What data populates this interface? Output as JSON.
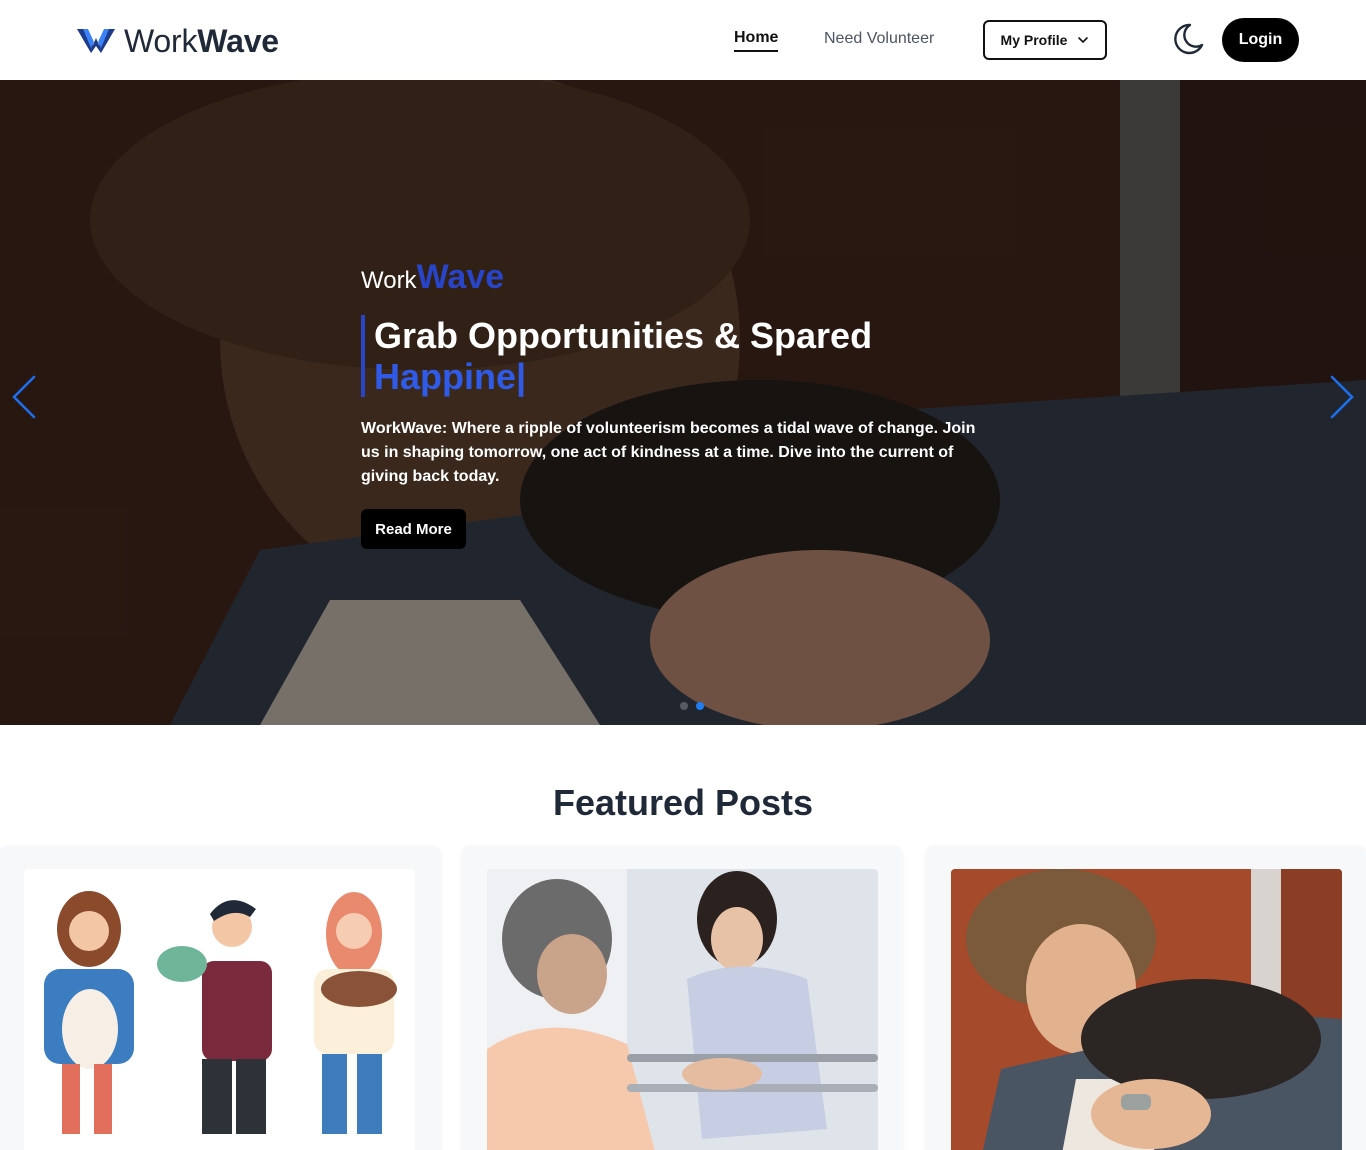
{
  "brand": {
    "part1": "Work",
    "part2": "Wave"
  },
  "nav": {
    "home": "Home",
    "need_volunteer": "Need Volunteer",
    "my_profile": "My Profile",
    "login": "Login"
  },
  "hero": {
    "brand_part1": "Work",
    "brand_part2": "Wave",
    "title_line1": "Grab Opportunities & Spared",
    "title_typed": "Happine",
    "caret": "|",
    "description": "WorkWave: Where a ripple of volunteerism becomes a tidal wave of change. Join us in shaping tomorrow, one act of kindness at a time. Dive into the current of giving back today.",
    "read_more": "Read More",
    "slide_count": 2,
    "active_slide": 2
  },
  "featured": {
    "title": "Featured Posts",
    "cards": [
      {
        "image": "kids-with-pets-illustration"
      },
      {
        "image": "nurse-helping-elderly-woman"
      },
      {
        "image": "man-hugging-dog"
      }
    ]
  },
  "colors": {
    "accent": "#2845c9",
    "caret_blue": "#2f5be8",
    "active_dot": "#1e7ef0",
    "button_black": "#000000"
  },
  "icons": {
    "logo": "workwave-logo-icon",
    "theme_toggle": "moon-icon",
    "dropdown": "chevron-down-icon",
    "prev": "chevron-left-icon",
    "next": "chevron-right-icon"
  }
}
